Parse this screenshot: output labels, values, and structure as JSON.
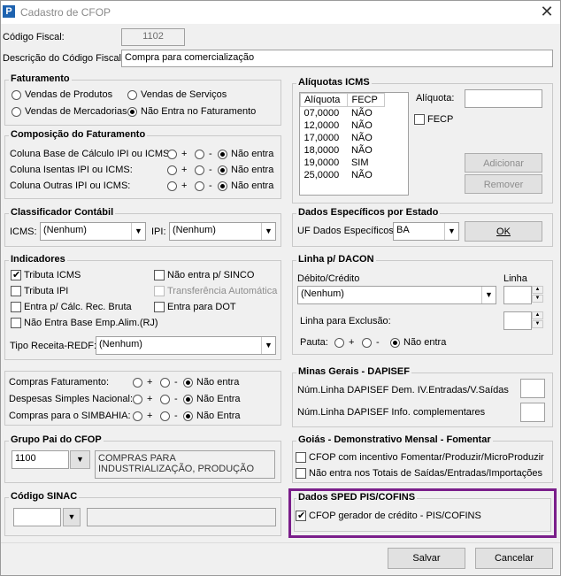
{
  "window": {
    "title": "Cadastro de CFOP",
    "icon": "app-p-icon",
    "close": "✕"
  },
  "header": {
    "codigo_fiscal_label": "Código Fiscal:",
    "codigo_fiscal_value": "1102",
    "descricao_label": "Descrição do Código Fiscal:",
    "descricao_value": "Compra para comercialização"
  },
  "faturamento": {
    "title": "Faturamento",
    "opt1": "Vendas de Produtos",
    "opt2": "Vendas de Serviços",
    "opt3": "Vendas de Mercadorias",
    "opt4": "Não Entra no Faturamento",
    "selected": "Não Entra no Faturamento"
  },
  "composicao": {
    "title": "Composição do Faturamento",
    "row1": "Coluna Base de Cálculo IPI ou ICMS:",
    "row2": "Coluna Isentas IPI ou ICMS:",
    "row3": "Coluna Outras IPI ou ICMS:",
    "plus": "+",
    "minus": "-",
    "nao_entra": "Não entra"
  },
  "classificador": {
    "title": "Classificador Contábil",
    "icms_label": "ICMS:",
    "icms_value": "(Nenhum)",
    "ipi_label": "IPI:",
    "ipi_value": "(Nenhum)"
  },
  "indicadores": {
    "title": "Indicadores",
    "tributa_icms": "Tributa ICMS",
    "tributa_ipi": "Tributa IPI",
    "entra_calc": "Entra p/ Cálc. Rec. Bruta",
    "nao_entra_base": "Não Entra Base Emp.Alim.(RJ)",
    "nao_entra_sinco": "Não entra p/ SINCO",
    "transferencia": "Transferência Automática",
    "entra_dot": "Entra para DOT",
    "tipo_receita_label": "Tipo Receita-REDF:",
    "tipo_receita_value": "(Nenhum)"
  },
  "compras": {
    "row1": "Compras Faturamento:",
    "row2": "Despesas Simples Nacional:",
    "row3": "Compras para o SIMBAHIA:",
    "plus": "+",
    "minus": "-",
    "nao_entra_lower": "Não entra",
    "nao_entra_upper": "Não Entra"
  },
  "grupo_pai": {
    "title": "Grupo Pai do CFOP",
    "code": "1100",
    "desc": "COMPRAS PARA INDUSTRIALIZAÇÃO, PRODUÇÃO"
  },
  "sinac": {
    "title": "Código SINAC"
  },
  "aliquotas": {
    "title": "Alíquotas ICMS",
    "col_aliquota": "Alíquota",
    "col_fecp": "FECP",
    "rows": [
      {
        "a": "07,0000",
        "f": "NÃO"
      },
      {
        "a": "12,0000",
        "f": "NÃO"
      },
      {
        "a": "17,0000",
        "f": "NÃO"
      },
      {
        "a": "18,0000",
        "f": "NÃO"
      },
      {
        "a": "19,0000",
        "f": "SIM"
      },
      {
        "a": "25,0000",
        "f": "NÃO"
      }
    ],
    "aliquota_label": "Alíquota:",
    "fecp_label": "FECP",
    "adicionar": "Adicionar",
    "remover": "Remover"
  },
  "especificos": {
    "title": "Dados Específicos por Estado",
    "uf_label": "UF Dados Específicos:",
    "uf_value": "BA",
    "ok": "OK"
  },
  "dacon": {
    "title": "Linha p/ DACON",
    "debito_label": "Débito/Crédito",
    "debito_value": "(Nenhum)",
    "linha_label": "Linha",
    "exclusao_label": "Linha para Exclusão:",
    "pauta_label": "Pauta:",
    "plus": "+",
    "minus": "-",
    "nao_entra": "Não entra"
  },
  "minas": {
    "title": "Minas Gerais - DAPISEF",
    "row1": "Núm.Linha DAPISEF Dem. IV.Entradas/V.Saídas",
    "row2": "Núm.Linha DAPISEF Info. complementares"
  },
  "goias": {
    "title": "Goiás - Demonstrativo Mensal - Fomentar",
    "opt1": "CFOP com incentivo  Fomentar/Produzir/MicroProduzir",
    "opt2": "Não entra nos Totais de  Saídas/Entradas/Importações"
  },
  "sped": {
    "title": "Dados SPED PIS/COFINS",
    "opt1": "CFOP gerador de crédito - PIS/COFINS",
    "highlight_color": "#7a1e8a"
  },
  "footer": {
    "salvar": "Salvar",
    "cancelar": "Cancelar"
  }
}
